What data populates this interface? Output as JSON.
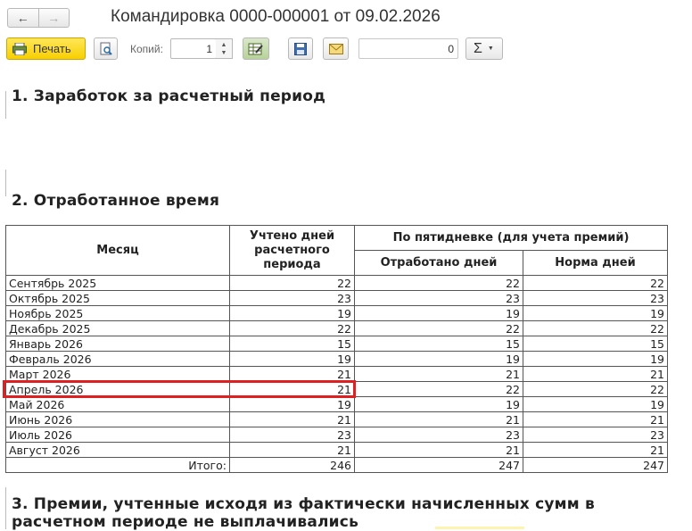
{
  "window": {
    "title": "Командировка 0000-000001 от 09.02.2026",
    "back_icon": "←",
    "forward_icon": "→"
  },
  "toolbar": {
    "print_label": "Печать",
    "copies_label": "Копий:",
    "copies_value": "1",
    "sum_value": "0",
    "sigma_label": "Σ",
    "accent_color": "#f7cf00"
  },
  "sections": {
    "s1_title": "1. Заработок за расчетный период",
    "s2_title": "2. Отработанное время",
    "s3_title": "3. Премии, учтенные исходя из фактически начисленных сумм в расчетном периоде не выплачивались"
  },
  "table": {
    "headers": {
      "month": "Месяц",
      "days_counted": "Учтено дней расчетного периода",
      "five_day_group": "По пятидневке (для учета премий)",
      "days_worked": "Отработано дней",
      "days_norm": "Норма дней"
    },
    "rows": [
      {
        "month": "Сентябрь 2025",
        "counted": "22",
        "worked": "22",
        "norm": "22"
      },
      {
        "month": "Октябрь 2025",
        "counted": "23",
        "worked": "23",
        "norm": "23"
      },
      {
        "month": "Ноябрь 2025",
        "counted": "19",
        "worked": "19",
        "norm": "19"
      },
      {
        "month": "Декабрь 2025",
        "counted": "22",
        "worked": "22",
        "norm": "22"
      },
      {
        "month": "Январь 2026",
        "counted": "15",
        "worked": "15",
        "norm": "15"
      },
      {
        "month": "Февраль 2026",
        "counted": "19",
        "worked": "19",
        "norm": "19"
      },
      {
        "month": "Март 2026",
        "counted": "21",
        "worked": "21",
        "norm": "21"
      },
      {
        "month": "Апрель 2026",
        "counted": "21",
        "worked": "22",
        "norm": "22"
      },
      {
        "month": "Май 2026",
        "counted": "19",
        "worked": "19",
        "norm": "19"
      },
      {
        "month": "Июнь 2026",
        "counted": "21",
        "worked": "21",
        "norm": "21"
      },
      {
        "month": "Июль 2026",
        "counted": "23",
        "worked": "23",
        "norm": "23"
      },
      {
        "month": "Август 2026",
        "counted": "21",
        "worked": "21",
        "norm": "21"
      }
    ],
    "total": {
      "label": "Итого:",
      "counted": "246",
      "worked": "247",
      "norm": "247"
    },
    "highlight_color": "#e02020"
  }
}
